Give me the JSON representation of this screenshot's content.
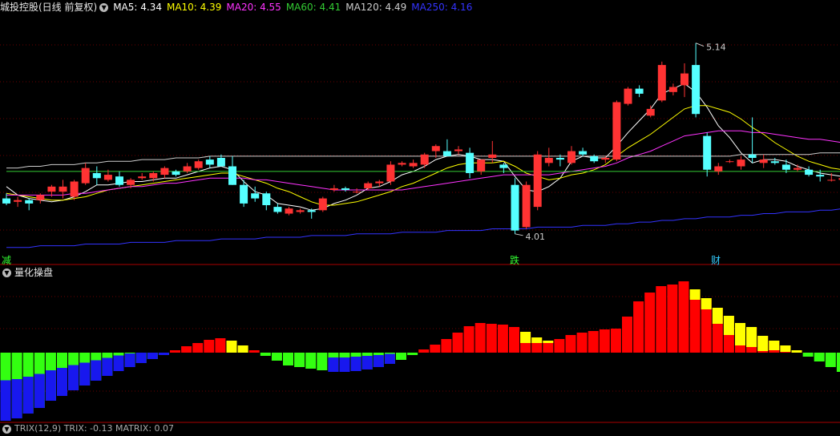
{
  "header": {
    "title": "城投控股(日线 前复权)",
    "ma": [
      {
        "label": "MA5: 4.34",
        "color": "#ffffff"
      },
      {
        "label": "MA10: 4.39",
        "color": "#ffff00"
      },
      {
        "label": "MA20: 4.55",
        "color": "#ff33ff"
      },
      {
        "label": "MA60: 4.41",
        "color": "#33cc33"
      },
      {
        "label": "MA120: 4.49",
        "color": "#cccccc"
      },
      {
        "label": "MA250: 4.16",
        "color": "#3333ff"
      }
    ]
  },
  "price_labels": {
    "high": "5.14",
    "low": "4.01"
  },
  "markers": [
    {
      "text": "减",
      "color": "#33ff33"
    },
    {
      "text": "跌",
      "color": "#33ff33"
    },
    {
      "text": "财",
      "color": "#33ccff"
    }
  ],
  "sub_header": {
    "title": "量化操盘"
  },
  "bottom_header": {
    "text": "TRIX(12,9)  TRIX: -0.13  MATRIX: 0.07"
  },
  "colors": {
    "up": "#ff3333",
    "down": "#55ffff",
    "grid": "#6a0000",
    "blue_base": "#1818ee",
    "yellow_cap": "#ffff00",
    "red_bar": "#ff0000",
    "green_bar": "#33ff11"
  },
  "chart_data": [
    {
      "type": "candlestick",
      "ylim": [
        3.9,
        5.3
      ],
      "candles": [
        {
          "o": 4.22,
          "h": 4.25,
          "l": 4.18,
          "c": 4.19
        },
        {
          "o": 4.2,
          "h": 4.23,
          "l": 4.17,
          "c": 4.21
        },
        {
          "o": 4.21,
          "h": 4.22,
          "l": 4.15,
          "c": 4.19
        },
        {
          "o": 4.21,
          "h": 4.25,
          "l": 4.19,
          "c": 4.24
        },
        {
          "o": 4.26,
          "h": 4.3,
          "l": 4.23,
          "c": 4.29
        },
        {
          "o": 4.26,
          "h": 4.33,
          "l": 4.22,
          "c": 4.29
        },
        {
          "o": 4.23,
          "h": 4.33,
          "l": 4.21,
          "c": 4.32
        },
        {
          "o": 4.31,
          "h": 4.43,
          "l": 4.3,
          "c": 4.4
        },
        {
          "o": 4.37,
          "h": 4.41,
          "l": 4.3,
          "c": 4.34
        },
        {
          "o": 4.33,
          "h": 4.39,
          "l": 4.32,
          "c": 4.36
        },
        {
          "o": 4.35,
          "h": 4.38,
          "l": 4.29,
          "c": 4.3
        },
        {
          "o": 4.3,
          "h": 4.34,
          "l": 4.28,
          "c": 4.33
        },
        {
          "o": 4.34,
          "h": 4.37,
          "l": 4.33,
          "c": 4.35
        },
        {
          "o": 4.34,
          "h": 4.38,
          "l": 4.32,
          "c": 4.37
        },
        {
          "o": 4.36,
          "h": 4.41,
          "l": 4.34,
          "c": 4.4
        },
        {
          "o": 4.38,
          "h": 4.39,
          "l": 4.35,
          "c": 4.36
        },
        {
          "o": 4.38,
          "h": 4.43,
          "l": 4.37,
          "c": 4.41
        },
        {
          "o": 4.4,
          "h": 4.45,
          "l": 4.39,
          "c": 4.44
        },
        {
          "o": 4.45,
          "h": 4.47,
          "l": 4.4,
          "c": 4.42
        },
        {
          "o": 4.46,
          "h": 4.48,
          "l": 4.43,
          "c": 4.41
        },
        {
          "o": 4.41,
          "h": 4.47,
          "l": 4.3,
          "c": 4.3
        },
        {
          "o": 4.3,
          "h": 4.33,
          "l": 4.17,
          "c": 4.19
        },
        {
          "o": 4.25,
          "h": 4.29,
          "l": 4.2,
          "c": 4.22
        },
        {
          "o": 4.25,
          "h": 4.26,
          "l": 4.15,
          "c": 4.18
        },
        {
          "o": 4.17,
          "h": 4.19,
          "l": 4.13,
          "c": 4.14
        },
        {
          "o": 4.13,
          "h": 4.17,
          "l": 4.12,
          "c": 4.16
        },
        {
          "o": 4.14,
          "h": 4.16,
          "l": 4.13,
          "c": 4.15
        },
        {
          "o": 4.15,
          "h": 4.16,
          "l": 4.1,
          "c": 4.14
        },
        {
          "o": 4.15,
          "h": 4.23,
          "l": 4.14,
          "c": 4.22
        },
        {
          "o": 4.27,
          "h": 4.3,
          "l": 4.26,
          "c": 4.28
        },
        {
          "o": 4.28,
          "h": 4.29,
          "l": 4.26,
          "c": 4.27
        },
        {
          "o": 4.26,
          "h": 4.28,
          "l": 4.25,
          "c": 4.26
        },
        {
          "o": 4.28,
          "h": 4.32,
          "l": 4.27,
          "c": 4.31
        },
        {
          "o": 4.31,
          "h": 4.33,
          "l": 4.29,
          "c": 4.32
        },
        {
          "o": 4.32,
          "h": 4.44,
          "l": 4.3,
          "c": 4.42
        },
        {
          "o": 4.42,
          "h": 4.44,
          "l": 4.41,
          "c": 4.43
        },
        {
          "o": 4.41,
          "h": 4.45,
          "l": 4.4,
          "c": 4.43
        },
        {
          "o": 4.42,
          "h": 4.49,
          "l": 4.4,
          "c": 4.48
        },
        {
          "o": 4.5,
          "h": 4.54,
          "l": 4.46,
          "c": 4.53
        },
        {
          "o": 4.5,
          "h": 4.57,
          "l": 4.49,
          "c": 4.47
        },
        {
          "o": 4.5,
          "h": 4.53,
          "l": 4.48,
          "c": 4.51
        },
        {
          "o": 4.49,
          "h": 4.52,
          "l": 4.34,
          "c": 4.37
        },
        {
          "o": 4.38,
          "h": 4.45,
          "l": 4.36,
          "c": 4.45
        },
        {
          "o": 4.46,
          "h": 4.56,
          "l": 4.43,
          "c": 4.48
        },
        {
          "o": 4.42,
          "h": 4.43,
          "l": 4.37,
          "c": 4.4
        },
        {
          "o": 4.3,
          "h": 4.34,
          "l": 4.01,
          "c": 4.03
        },
        {
          "o": 4.05,
          "h": 4.32,
          "l": 4.04,
          "c": 4.3
        },
        {
          "o": 4.17,
          "h": 4.5,
          "l": 4.15,
          "c": 4.48
        },
        {
          "o": 4.43,
          "h": 4.52,
          "l": 4.41,
          "c": 4.46
        },
        {
          "o": 4.46,
          "h": 4.48,
          "l": 4.41,
          "c": 4.45
        },
        {
          "o": 4.43,
          "h": 4.53,
          "l": 4.42,
          "c": 4.5
        },
        {
          "o": 4.5,
          "h": 4.52,
          "l": 4.47,
          "c": 4.48
        },
        {
          "o": 4.47,
          "h": 4.48,
          "l": 4.43,
          "c": 4.44
        },
        {
          "o": 4.45,
          "h": 4.47,
          "l": 4.43,
          "c": 4.46
        },
        {
          "o": 4.45,
          "h": 4.8,
          "l": 4.44,
          "c": 4.79
        },
        {
          "o": 4.78,
          "h": 4.88,
          "l": 4.77,
          "c": 4.87
        },
        {
          "o": 4.87,
          "h": 4.89,
          "l": 4.82,
          "c": 4.84
        },
        {
          "o": 4.71,
          "h": 4.77,
          "l": 4.7,
          "c": 4.75
        },
        {
          "o": 4.8,
          "h": 5.03,
          "l": 4.79,
          "c": 5.01
        },
        {
          "o": 4.85,
          "h": 4.9,
          "l": 4.83,
          "c": 4.88
        },
        {
          "o": 4.89,
          "h": 5.02,
          "l": 4.82,
          "c": 4.96
        },
        {
          "o": 5.01,
          "h": 5.14,
          "l": 4.7,
          "c": 4.72
        },
        {
          "o": 4.59,
          "h": 4.61,
          "l": 4.35,
          "c": 4.39
        },
        {
          "o": 4.38,
          "h": 4.43,
          "l": 4.36,
          "c": 4.41
        },
        {
          "o": 4.44,
          "h": 4.45,
          "l": 4.43,
          "c": 4.44
        },
        {
          "o": 4.41,
          "h": 4.47,
          "l": 4.39,
          "c": 4.45
        },
        {
          "o": 4.48,
          "h": 4.7,
          "l": 4.43,
          "c": 4.46
        },
        {
          "o": 4.43,
          "h": 4.48,
          "l": 4.4,
          "c": 4.45
        },
        {
          "o": 4.44,
          "h": 4.46,
          "l": 4.42,
          "c": 4.43
        },
        {
          "o": 4.42,
          "h": 4.45,
          "l": 4.37,
          "c": 4.39
        },
        {
          "o": 4.39,
          "h": 4.42,
          "l": 4.38,
          "c": 4.4
        },
        {
          "o": 4.39,
          "h": 4.41,
          "l": 4.35,
          "c": 4.36
        },
        {
          "o": 4.36,
          "h": 4.39,
          "l": 4.32,
          "c": 4.35
        },
        {
          "o": 4.33,
          "h": 4.37,
          "l": 4.32,
          "c": 4.33
        },
        {
          "o": 4.33,
          "h": 4.34,
          "l": 4.31,
          "c": 4.34
        },
        {
          "o": 4.35,
          "h": 4.37,
          "l": 4.32,
          "c": 4.33
        }
      ],
      "ma_values": {
        "MA5": [
          4.29,
          4.24,
          4.22,
          4.21,
          4.2,
          4.21,
          4.23,
          4.26,
          4.3,
          4.3,
          4.31,
          4.32,
          4.32,
          4.33,
          4.34,
          4.34,
          4.36,
          4.38,
          4.4,
          4.41,
          4.39,
          4.32,
          4.26,
          4.24,
          4.19,
          4.18,
          4.17,
          4.15,
          4.16,
          4.19,
          4.21,
          4.24,
          4.28,
          4.29,
          4.32,
          4.36,
          4.38,
          4.41,
          4.45,
          4.47,
          4.48,
          4.47,
          4.45,
          4.45,
          4.44,
          4.35,
          4.27,
          4.26,
          4.29,
          4.34,
          4.44,
          4.47,
          4.46,
          4.46,
          4.53,
          4.61,
          4.68,
          4.75,
          4.84,
          4.87,
          4.9,
          4.85,
          4.76,
          4.65,
          4.58,
          4.49,
          4.43,
          4.45,
          4.45,
          4.44,
          4.41,
          4.39,
          4.37,
          4.36,
          4.35
        ],
        "MA10": [
          4.25,
          4.24,
          4.23,
          4.22,
          4.21,
          4.21,
          4.22,
          4.23,
          4.25,
          4.27,
          4.28,
          4.29,
          4.3,
          4.31,
          4.32,
          4.33,
          4.34,
          4.35,
          4.36,
          4.37,
          4.37,
          4.35,
          4.33,
          4.31,
          4.28,
          4.26,
          4.23,
          4.2,
          4.18,
          4.18,
          4.19,
          4.2,
          4.22,
          4.24,
          4.26,
          4.29,
          4.31,
          4.34,
          4.37,
          4.4,
          4.42,
          4.43,
          4.43,
          4.43,
          4.44,
          4.41,
          4.37,
          4.35,
          4.33,
          4.34,
          4.36,
          4.37,
          4.39,
          4.42,
          4.47,
          4.52,
          4.56,
          4.6,
          4.65,
          4.7,
          4.75,
          4.77,
          4.77,
          4.75,
          4.73,
          4.69,
          4.64,
          4.6,
          4.55,
          4.51,
          4.47,
          4.44,
          4.42,
          4.4,
          4.39
        ],
        "MA20": [
          4.24,
          4.24,
          4.24,
          4.24,
          4.24,
          4.24,
          4.25,
          4.25,
          4.26,
          4.27,
          4.28,
          4.29,
          4.29,
          4.3,
          4.31,
          4.31,
          4.32,
          4.33,
          4.34,
          4.34,
          4.34,
          4.34,
          4.33,
          4.33,
          4.32,
          4.31,
          4.3,
          4.29,
          4.28,
          4.27,
          4.27,
          4.27,
          4.27,
          4.27,
          4.27,
          4.27,
          4.28,
          4.29,
          4.3,
          4.31,
          4.32,
          4.33,
          4.34,
          4.35,
          4.36,
          4.36,
          4.36,
          4.36,
          4.36,
          4.37,
          4.38,
          4.39,
          4.4,
          4.41,
          4.43,
          4.46,
          4.48,
          4.5,
          4.53,
          4.56,
          4.59,
          4.6,
          4.61,
          4.62,
          4.62,
          4.62,
          4.61,
          4.61,
          4.6,
          4.59,
          4.58,
          4.57,
          4.57,
          4.56,
          4.55
        ],
        "MA60": [
          4.38,
          4.38,
          4.38,
          4.38,
          4.38,
          4.38,
          4.38,
          4.38,
          4.38,
          4.38,
          4.38,
          4.38,
          4.38,
          4.38,
          4.38,
          4.38,
          4.38,
          4.38,
          4.38,
          4.38,
          4.38,
          4.38,
          4.38,
          4.38,
          4.38,
          4.38,
          4.38,
          4.38,
          4.38,
          4.38,
          4.38,
          4.38,
          4.38,
          4.38,
          4.38,
          4.38,
          4.38,
          4.38,
          4.38,
          4.38,
          4.38,
          4.38,
          4.38,
          4.38,
          4.38,
          4.38,
          4.38,
          4.38,
          4.38,
          4.38,
          4.38,
          4.38,
          4.38,
          4.38,
          4.38,
          4.38,
          4.38,
          4.38,
          4.38,
          4.38,
          4.38,
          4.38,
          4.38,
          4.38,
          4.38,
          4.38,
          4.38,
          4.38,
          4.38,
          4.38,
          4.38,
          4.38,
          4.38,
          4.38,
          4.38
        ],
        "MA120": [
          4.4,
          4.4,
          4.41,
          4.41,
          4.42,
          4.42,
          4.42,
          4.43,
          4.43,
          4.44,
          4.44,
          4.44,
          4.45,
          4.45,
          4.45,
          4.46,
          4.46,
          4.46,
          4.47,
          4.47,
          4.47,
          4.47,
          4.47,
          4.47,
          4.47,
          4.47,
          4.47,
          4.47,
          4.47,
          4.47,
          4.47,
          4.47,
          4.47,
          4.47,
          4.47,
          4.47,
          4.47,
          4.47,
          4.47,
          4.47,
          4.47,
          4.47,
          4.47,
          4.47,
          4.47,
          4.47,
          4.47,
          4.47,
          4.47,
          4.47,
          4.47,
          4.47,
          4.47,
          4.47,
          4.47,
          4.47,
          4.47,
          4.47,
          4.47,
          4.47,
          4.47,
          4.47,
          4.47,
          4.47,
          4.47,
          4.48,
          4.48,
          4.48,
          4.48,
          4.48,
          4.48,
          4.48,
          4.49,
          4.49,
          4.49
        ],
        "MA250": [
          3.93,
          3.93,
          3.93,
          3.94,
          3.94,
          3.94,
          3.94,
          3.95,
          3.95,
          3.95,
          3.95,
          3.96,
          3.96,
          3.96,
          3.96,
          3.97,
          3.97,
          3.97,
          3.97,
          3.98,
          3.98,
          3.98,
          3.98,
          3.99,
          3.99,
          3.99,
          3.99,
          4.0,
          4.0,
          4.0,
          4.0,
          4.01,
          4.01,
          4.01,
          4.01,
          4.02,
          4.02,
          4.02,
          4.02,
          4.03,
          4.03,
          4.03,
          4.03,
          4.04,
          4.04,
          4.04,
          4.04,
          4.05,
          4.05,
          4.05,
          4.05,
          4.06,
          4.06,
          4.06,
          4.07,
          4.07,
          4.08,
          4.08,
          4.09,
          4.09,
          4.1,
          4.1,
          4.11,
          4.11,
          4.11,
          4.12,
          4.12,
          4.13,
          4.13,
          4.14,
          4.14,
          4.14,
          4.15,
          4.15,
          4.16
        ]
      }
    },
    {
      "type": "bar",
      "title": "量化操盘",
      "ylim": [
        -9,
        10
      ],
      "values": [
        -8.5,
        -8.2,
        -7.6,
        -6.9,
        -6.0,
        -5.4,
        -4.7,
        -4.1,
        -3.5,
        -2.9,
        -2.3,
        -1.8,
        -1.3,
        -0.8,
        -0.3,
        0.3,
        0.8,
        1.2,
        1.6,
        1.8,
        1.5,
        0.9,
        0.3,
        -0.4,
        -1.0,
        -1.6,
        -1.8,
        -2.0,
        -2.2,
        -2.4,
        -2.4,
        -2.3,
        -2.1,
        -1.8,
        -1.4,
        -0.9,
        -0.3,
        0.4,
        1.0,
        1.7,
        2.5,
        3.3,
        3.7,
        3.6,
        3.5,
        3.2,
        2.6,
        1.9,
        1.5,
        1.7,
        2.2,
        2.5,
        2.7,
        2.9,
        3.0,
        4.5,
        6.4,
        7.5,
        8.3,
        8.5,
        8.9,
        7.9,
        6.8,
        5.6,
        4.6,
        3.7,
        3.2,
        2.1,
        1.5,
        0.9,
        0.3,
        -0.5,
        -1.1,
        -1.8,
        -2.4
      ],
      "blue_base": [
        -8.5,
        -8.2,
        -7.6,
        -6.9,
        -6.0,
        -5.4,
        -4.7,
        -4.1,
        -3.5,
        -2.9,
        -2.3,
        -1.8,
        -1.3,
        -0.8,
        -0.3,
        0,
        0,
        0,
        0,
        0,
        0,
        0,
        0,
        0,
        0,
        0,
        0,
        0,
        0,
        -2.0,
        -2.0,
        -2.0,
        -1.8,
        -1.4,
        -0.9,
        0,
        0,
        0,
        0,
        0,
        0,
        0,
        0,
        0,
        0,
        0,
        0,
        0,
        0,
        0,
        0,
        0,
        0,
        0,
        0,
        0,
        0,
        0,
        0,
        0,
        0,
        0,
        0,
        0,
        0,
        0,
        0,
        0,
        0,
        0,
        0,
        0,
        0,
        0,
        0
      ],
      "yellow_cap": [
        0,
        0,
        0,
        0,
        0,
        0,
        0,
        0,
        0,
        0,
        0,
        0,
        0,
        0,
        0,
        0,
        0,
        0,
        0,
        0,
        1.5,
        0.9,
        0,
        0,
        0,
        0,
        0,
        0,
        0,
        0,
        0,
        0,
        0,
        0,
        0,
        0,
        0,
        0,
        0,
        0,
        0,
        0,
        0,
        0,
        0,
        0,
        1.4,
        0.7,
        0.3,
        0,
        0,
        0,
        0,
        0,
        0,
        0,
        0,
        0,
        0,
        0,
        0,
        1.3,
        1.4,
        2.0,
        2.4,
        2.8,
        2.5,
        1.9,
        1.2,
        0.8,
        0.5,
        0,
        0,
        0,
        0
      ]
    }
  ]
}
